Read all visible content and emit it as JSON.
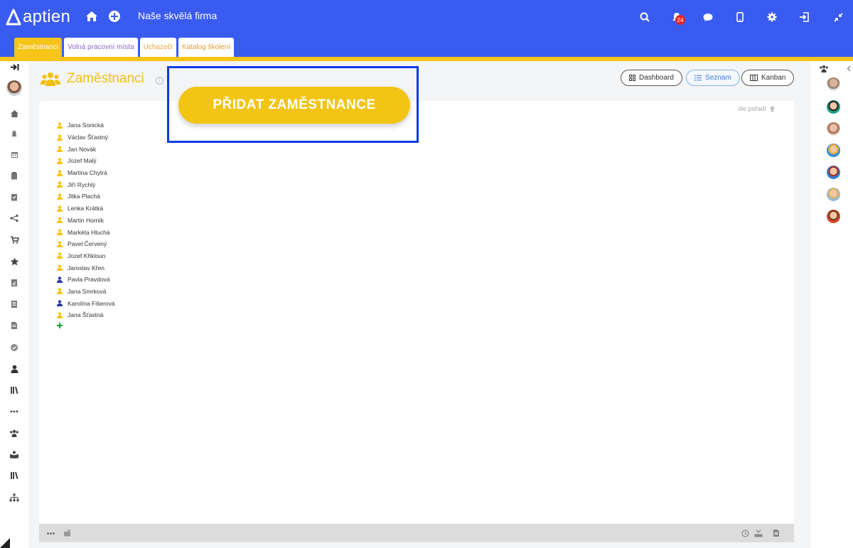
{
  "brand": {
    "logo_text": "aptien",
    "primary": "#3a5bf0",
    "accent": "#f5c518"
  },
  "header": {
    "company_name": "Naše skvělá firma",
    "notification_count": "24",
    "icons": [
      "home-icon",
      "plus-circle-icon",
      "search-icon",
      "bell-icon",
      "chat-icon",
      "mobile-icon",
      "gear-icon",
      "logout-icon",
      "compress-icon"
    ]
  },
  "tabs": [
    {
      "label": "Zaměstnanci",
      "active": true
    },
    {
      "label": "Volná pracovní místa",
      "active": false
    },
    {
      "label": "Uchazeči",
      "active": false
    },
    {
      "label": "Katalog školení",
      "active": false
    }
  ],
  "page": {
    "title": "Zaměstnanci",
    "cta_label": "PŘIDAT ZAMĚSTNANCE",
    "sort_label": "dle pořadí"
  },
  "views": [
    {
      "label": "Dashboard",
      "active": false
    },
    {
      "label": "Seznam",
      "active": true
    },
    {
      "label": "Kanban",
      "active": false
    }
  ],
  "employees": [
    {
      "name": "Jana Sonická",
      "icon_color": "#f5c518"
    },
    {
      "name": "Václav Šťastný",
      "icon_color": "#f5c518"
    },
    {
      "name": "Jan Novák",
      "icon_color": "#f5c518"
    },
    {
      "name": "Jozef Malý",
      "icon_color": "#f5c518"
    },
    {
      "name": "Martina Chytrá",
      "icon_color": "#f5c518"
    },
    {
      "name": "Jiří Rychlý",
      "icon_color": "#f5c518"
    },
    {
      "name": "Jitka Plachá",
      "icon_color": "#f5c518"
    },
    {
      "name": "Lenka Krátká",
      "icon_color": "#f5c518"
    },
    {
      "name": "Martin Horník",
      "icon_color": "#f5c518"
    },
    {
      "name": "Markéta Hluchá",
      "icon_color": "#f5c518"
    },
    {
      "name": "Pavel Červený",
      "icon_color": "#f5c518"
    },
    {
      "name": "Jozef Křikloun",
      "icon_color": "#f5c518"
    },
    {
      "name": "Jaroslav Křen",
      "icon_color": "#f5c518"
    },
    {
      "name": "Pavla Pravdová",
      "icon_color": "#2c3a9e"
    },
    {
      "name": "Jana Smrková",
      "icon_color": "#f5c518"
    },
    {
      "name": "Karolína Fišerová",
      "icon_color": "#2c3a9e"
    },
    {
      "name": "Jana Šťastná",
      "icon_color": "#f5c518"
    }
  ]
}
